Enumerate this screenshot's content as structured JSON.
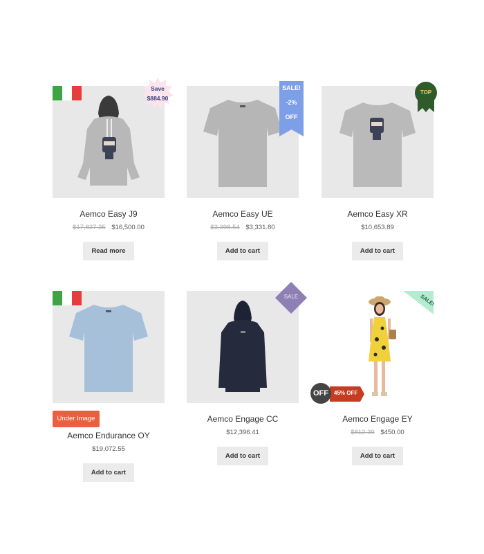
{
  "products": [
    {
      "title": "Aemco Easy J9",
      "old_price": "$17,827.35",
      "price": "$16,500.00",
      "button": "Read more"
    },
    {
      "title": "Aemco Easy UE",
      "old_price": "$3,398.54",
      "price": "$3,331.80",
      "button": "Add to cart"
    },
    {
      "title": "Aemco Easy XR",
      "old_price": "",
      "price": "$10,653.89",
      "button": "Add to cart"
    },
    {
      "title": "Aemco Endurance OY",
      "old_price": "",
      "price": "$19,072.55",
      "button": "Add to cart"
    },
    {
      "title": "Aemco Engage CC",
      "old_price": "",
      "price": "$12,396.41",
      "button": "Add to cart"
    },
    {
      "title": "Aemco Engage EY",
      "old_price": "$812.39",
      "price": "$450.00",
      "button": "Add to cart"
    }
  ],
  "badges": {
    "save_label": "Save",
    "save_amount": "$884.90",
    "sale_ribbon": [
      "SALE!",
      "-2%",
      "OFF"
    ],
    "top": "TOP",
    "sale_diamond": "SALE",
    "sale_corner": "SALE!",
    "under_image": "Under Image",
    "off_circle": "OFF",
    "off_tag": "45% OFF"
  },
  "colors": {
    "flag_green": "#3ea443",
    "flag_white": "#ffffff",
    "flag_red": "#e63c3c",
    "save_star": "#fbe4ec",
    "sale_ribbon": "#7d9fe8",
    "top_badge": "#2f5a2a",
    "diamond": "#8e7fb4",
    "corner": "#b4ecd2",
    "under_image": "#e9603e",
    "off_tag": "#c53c22",
    "off_circle": "#444444"
  }
}
